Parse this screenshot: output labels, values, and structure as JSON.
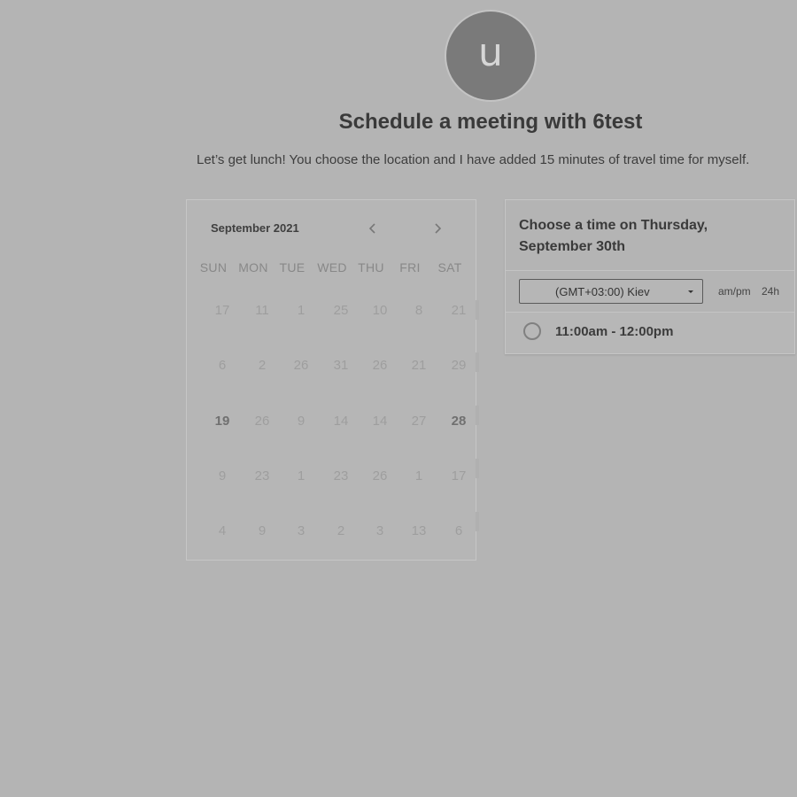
{
  "header": {
    "avatar_initial": "u",
    "title": "Schedule a meeting with 6test",
    "description": "Let’s get lunch! You choose the location and I have added 15 minutes of travel time for myself."
  },
  "calendar": {
    "month_label": "September 2021",
    "prev_icon": "chevron-left-icon",
    "next_icon": "chevron-right-icon",
    "weekdays": [
      "SUN",
      "MON",
      "TUE",
      "WED",
      "THU",
      "FRI",
      "SAT"
    ],
    "weeks": [
      [
        "17",
        "11",
        "1",
        "25",
        "10",
        "8",
        "21"
      ],
      [
        "6",
        "2",
        "26",
        "31",
        "26",
        "21",
        "29"
      ],
      [
        "19",
        "26",
        "9",
        "14",
        "14",
        "27",
        "28"
      ],
      [
        "9",
        "23",
        "1",
        "23",
        "26",
        "1",
        "17"
      ],
      [
        "4",
        "9",
        "3",
        "2",
        "3",
        "13",
        "6"
      ]
    ]
  },
  "time_panel": {
    "title": "Choose a time on Thursday, September 30th",
    "timezone": "(GMT+03:00) Kiev",
    "format_ampm": "am/pm",
    "format_24h": "24h",
    "slots": [
      {
        "label": "11:00am - 12:00pm"
      }
    ]
  },
  "colors": {
    "background": "#b4b4b4",
    "avatar": "#7a7a7a",
    "text_dark": "#3a3a3a",
    "day_muted": "#9e9e9e",
    "day_active": "#707070"
  }
}
